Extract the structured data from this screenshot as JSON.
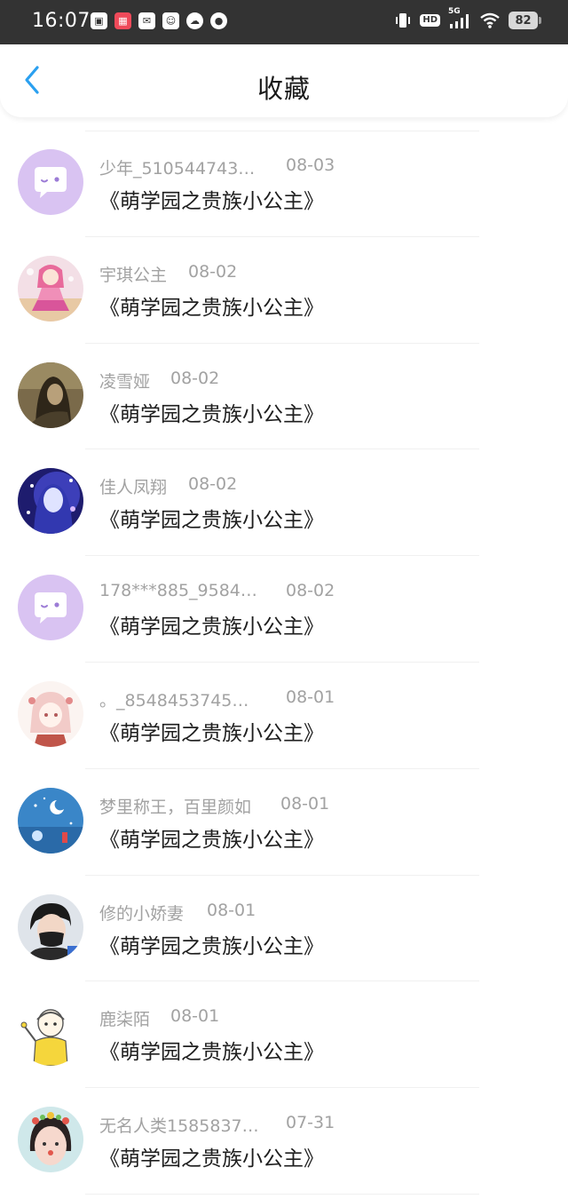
{
  "status_bar": {
    "time": "16:07",
    "network": "5G",
    "hd": "HD",
    "battery": "82"
  },
  "header": {
    "title": "收藏"
  },
  "colors": {
    "accent": "#2aa0f0",
    "status_bar_bg": "#333333",
    "meta_text": "#a2a2a2"
  },
  "favorites": [
    {
      "user": "少年_510544743…",
      "date": "08-03",
      "work": "《萌学园之贵族小公主》",
      "avatar": "default-chat-avatar"
    },
    {
      "user": "宇琪公主",
      "date": "08-02",
      "work": "《萌学园之贵族小公主》",
      "avatar": "anime-princess-avatar"
    },
    {
      "user": "凌雪娅",
      "date": "08-02",
      "work": "《萌学园之贵族小公主》",
      "avatar": "sepia-portrait-avatar"
    },
    {
      "user": "佳人凤翔",
      "date": "08-02",
      "work": "《萌学园之贵族小公主》",
      "avatar": "blue-glow-girl-avatar"
    },
    {
      "user": "178***885_9584…",
      "date": "08-02",
      "work": "《萌学园之贵族小公主》",
      "avatar": "default-chat-avatar"
    },
    {
      "user": "。_8548453745…",
      "date": "08-01",
      "work": "《萌学园之贵族小公主》",
      "avatar": "anime-sketch-girl-avatar"
    },
    {
      "user": "梦里称王，百里颜如",
      "date": "08-01",
      "work": "《萌学园之贵族小公主》",
      "avatar": "blue-night-avatar"
    },
    {
      "user": "修的小娇妻",
      "date": "08-01",
      "work": "《萌学园之贵族小公主》",
      "avatar": "masked-boy-avatar"
    },
    {
      "user": "鹿柒陌",
      "date": "08-01",
      "work": "《萌学园之贵族小公主》",
      "avatar": "yellow-cartoon-avatar"
    },
    {
      "user": "无名人类1585837…",
      "date": "07-31",
      "work": "《萌学园之贵族小公主》",
      "avatar": "girl-flower-crown-avatar"
    }
  ]
}
